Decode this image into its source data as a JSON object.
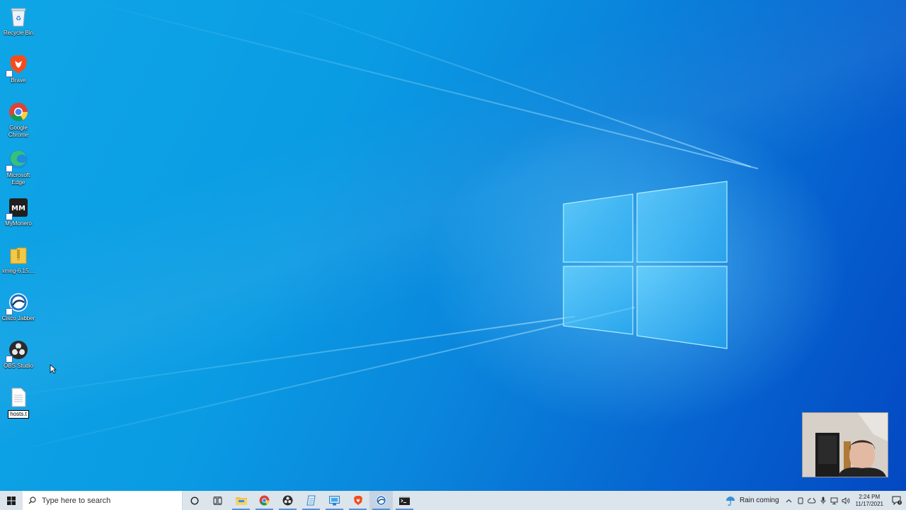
{
  "desktop": {
    "icons": [
      {
        "label": "Recycle Bin",
        "icon": "recycle-bin-icon"
      },
      {
        "label": "Brave",
        "icon": "brave-icon"
      },
      {
        "label": "Google Chrome",
        "icon": "chrome-icon"
      },
      {
        "label": "Microsoft Edge",
        "icon": "edge-icon"
      },
      {
        "label": "MyMonero",
        "icon": "mymonero-icon"
      },
      {
        "label": "xmrig-6.15....",
        "icon": "folder-zip-icon"
      },
      {
        "label": "Cisco Jabber",
        "icon": "cisco-jabber-icon"
      },
      {
        "label": "OBS Studio",
        "icon": "obs-icon"
      },
      {
        "label": "hosts.t",
        "icon": "text-file-icon"
      }
    ]
  },
  "taskbar": {
    "search_placeholder": "Type here to search",
    "weather_text": "Rain coming",
    "time": "2:24 PM",
    "date": "11/17/2021",
    "notification_count": "4"
  },
  "colors": {
    "accent": "#0a86dc",
    "taskbar_bg": "#dce4ec"
  }
}
